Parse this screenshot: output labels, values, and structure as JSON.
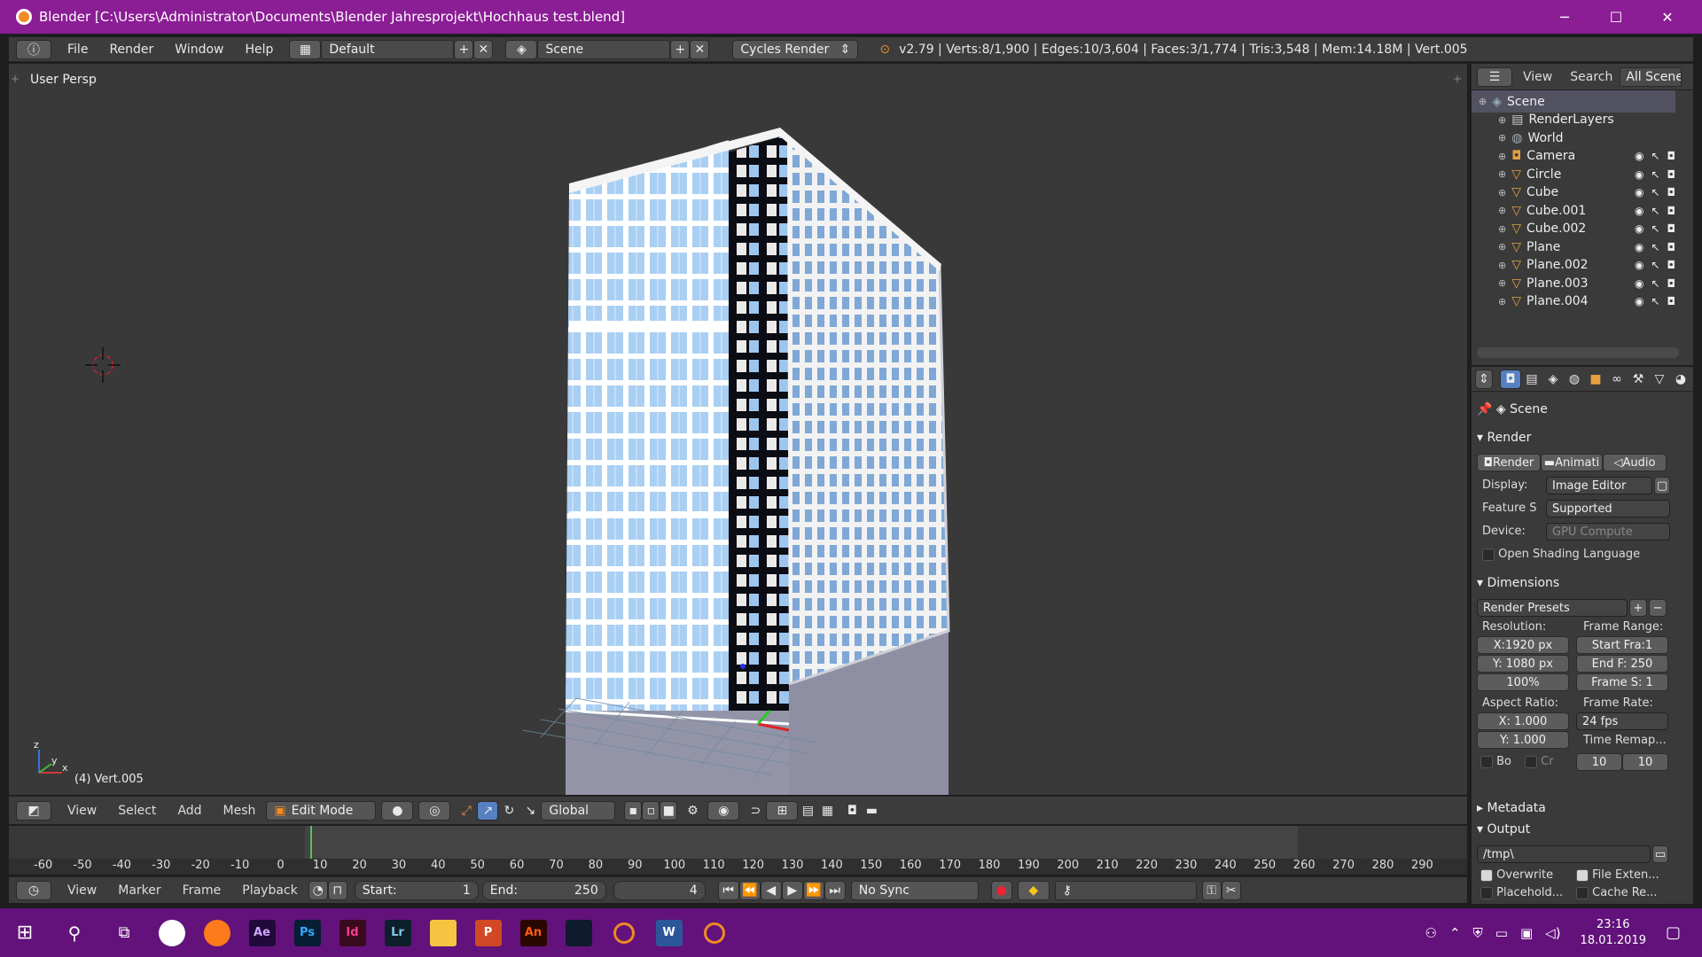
{
  "window": {
    "title": "Blender [C:\\Users\\Administrator\\Documents\\Blender Jahresprojekt\\Hochhaus test.blend]",
    "minimize": "─",
    "maximize": "☐",
    "close": "✕"
  },
  "header": {
    "menus": [
      "File",
      "Render",
      "Window",
      "Help"
    ],
    "layout": "Default",
    "scene": "Scene",
    "engine": "Cycles Render",
    "stats": "v2.79 | Verts:8/1,900 | Edges:10/3,604 | Faces:3/1,774 | Tris:3,548 | Mem:14.18M | Vert.005"
  },
  "viewport": {
    "view_name": "User Persp",
    "object_info": "(4) Vert.005",
    "axis_z": "z",
    "axis_y": "y",
    "axis_x": "x"
  },
  "viewport_toolbar": {
    "menus": [
      "View",
      "Select",
      "Add",
      "Mesh"
    ],
    "mode": "Edit Mode",
    "orientation": "Global"
  },
  "timeline": {
    "ticks": [
      "-60",
      "-50",
      "-40",
      "-30",
      "-20",
      "-10",
      "0",
      "10",
      "20",
      "30",
      "40",
      "50",
      "60",
      "70",
      "80",
      "90",
      "100",
      "110",
      "120",
      "130",
      "140",
      "150",
      "160",
      "170",
      "180",
      "190",
      "200",
      "210",
      "220",
      "230",
      "240",
      "250",
      "260",
      "270",
      "280",
      "290"
    ],
    "current_frame_marker": 4
  },
  "timeline_footer": {
    "menus": [
      "View",
      "Marker",
      "Frame",
      "Playback"
    ],
    "start_label": "Start:",
    "start_value": "1",
    "end_label": "End:",
    "end_value": "250",
    "current": "4",
    "sync": "No Sync"
  },
  "outliner": {
    "menus": [
      "View",
      "Search"
    ],
    "filter": "All Scenes",
    "items": [
      {
        "label": "Scene",
        "icon": "scene-icon",
        "indent": 0
      },
      {
        "label": "RenderLayers",
        "icon": "renderlayers-icon",
        "indent": 1
      },
      {
        "label": "World",
        "icon": "world-icon",
        "indent": 1
      },
      {
        "label": "Camera",
        "icon": "camera-icon",
        "indent": 1
      },
      {
        "label": "Circle",
        "icon": "mesh-icon",
        "indent": 1
      },
      {
        "label": "Cube",
        "icon": "mesh-icon",
        "indent": 1
      },
      {
        "label": "Cube.001",
        "icon": "mesh-icon",
        "indent": 1
      },
      {
        "label": "Cube.002",
        "icon": "mesh-icon",
        "indent": 1
      },
      {
        "label": "Plane",
        "icon": "mesh-icon",
        "indent": 1
      },
      {
        "label": "Plane.002",
        "icon": "mesh-icon",
        "indent": 1
      },
      {
        "label": "Plane.003",
        "icon": "mesh-icon",
        "indent": 1
      },
      {
        "label": "Plane.004",
        "icon": "mesh-icon",
        "indent": 1
      }
    ]
  },
  "properties": {
    "context": "Scene",
    "render_section": "Render",
    "render_buttons": [
      "Render",
      "Animati",
      "Audio"
    ],
    "display_label": "Display:",
    "display_value": "Image Editor",
    "feature_label": "Feature S",
    "feature_value": "Supported",
    "device_label": "Device:",
    "device_value": "GPU Compute",
    "osl_label": "Open Shading Language",
    "dimensions_section": "Dimensions",
    "presets": "Render Presets",
    "resolution_label": "Resolution:",
    "res_x": "X:1920 px",
    "res_y": "Y: 1080 px",
    "res_pct": "100%",
    "frame_range_label": "Frame Range:",
    "start_frame": "Start Fra:1",
    "end_frame": "End F: 250",
    "frame_step": "Frame S: 1",
    "aspect_label": "Aspect Ratio:",
    "aspect_x": "X:     1.000",
    "aspect_y": "Y:     1.000",
    "framerate_label": "Frame Rate:",
    "framerate": "24 fps",
    "remap_label": "Time Remap...",
    "remap_old": "10",
    "remap_new": "10",
    "border_label": "Bo",
    "crop_label": "Cr",
    "metadata_section": "Metadata",
    "output_section": "Output",
    "output_path": "/tmp\\",
    "overwrite": "Overwrite",
    "file_ext": "File Exten...",
    "placeholders": "Placehold...",
    "cache": "Cache Re..."
  },
  "taskbar": {
    "apps": [
      {
        "name": "chrome-icon",
        "label": "",
        "bg": "#ffffff",
        "fg": "#dd4b39"
      },
      {
        "name": "firefox-icon",
        "label": "",
        "bg": "#ff7a1a",
        "fg": "#fff"
      },
      {
        "name": "after-effects-icon",
        "label": "Ae",
        "bg": "#1f0a3a",
        "fg": "#d5a6ff"
      },
      {
        "name": "photoshop-icon",
        "label": "Ps",
        "bg": "#061e33",
        "fg": "#31a8ff"
      },
      {
        "name": "indesign-icon",
        "label": "Id",
        "bg": "#3a0a1f",
        "fg": "#ff3d8b"
      },
      {
        "name": "lightroom-icon",
        "label": "Lr",
        "bg": "#0d1f2b",
        "fg": "#7ecbe6"
      },
      {
        "name": "file-explorer-icon",
        "label": "",
        "bg": "#f5c542",
        "fg": "#8a6d16"
      },
      {
        "name": "powerpoint-icon",
        "label": "P",
        "bg": "#d24726",
        "fg": "#fff"
      },
      {
        "name": "animate-icon",
        "label": "An",
        "bg": "#2a0800",
        "fg": "#ff5a1a"
      },
      {
        "name": "vectorworks-icon",
        "label": "",
        "bg": "#0e1a2e",
        "fg": "#6fb0ff"
      },
      {
        "name": "blender-icon",
        "label": "",
        "bg": "#62127a",
        "fg": "#f08a24"
      },
      {
        "name": "word-icon",
        "label": "W",
        "bg": "#2b579a",
        "fg": "#fff"
      },
      {
        "name": "blender-icon-2",
        "label": "",
        "bg": "#62127a",
        "fg": "#f08a24"
      },
      {
        "name": "mail-icon",
        "label": "",
        "bg": "#62127a",
        "fg": "#fff"
      }
    ],
    "time": "23:16",
    "date": "18.01.2019"
  }
}
